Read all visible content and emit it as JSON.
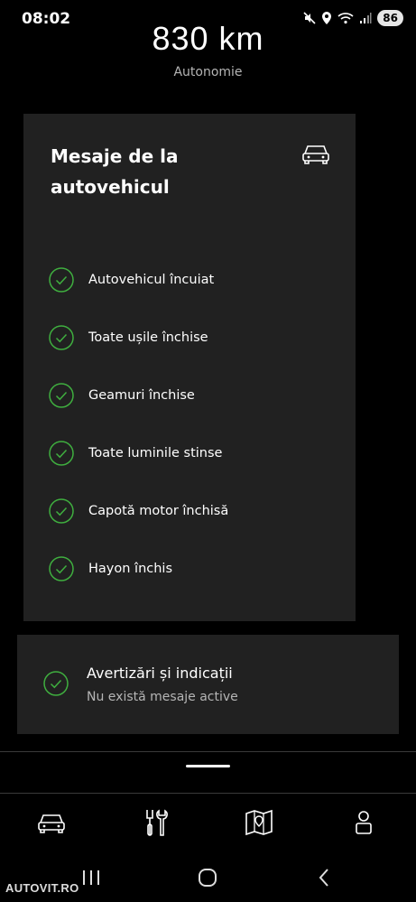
{
  "status_bar": {
    "time": "08:02",
    "battery": "86",
    "icons": [
      "mute-icon",
      "location-icon",
      "wifi-icon",
      "signal-icon"
    ]
  },
  "range": {
    "value": "830 km",
    "label": "Autonomie"
  },
  "vehicle_messages": {
    "title": "Mesaje de la autovehicul",
    "icon": "car-icon",
    "items": [
      {
        "label": "Autovehicul încuiat",
        "status": "ok"
      },
      {
        "label": "Toate ușile închise",
        "status": "ok"
      },
      {
        "label": "Geamuri închise",
        "status": "ok"
      },
      {
        "label": "Toate luminile stinse",
        "status": "ok"
      },
      {
        "label": "Capotă motor închisă",
        "status": "ok"
      },
      {
        "label": "Hayon închis",
        "status": "ok"
      }
    ]
  },
  "warnings": {
    "title": "Avertizări și indicații",
    "subtitle": "Nu există mesaje active",
    "status": "ok"
  },
  "tab_bar": {
    "tabs": [
      {
        "icon": "car-icon",
        "active": true
      },
      {
        "icon": "tools-icon",
        "active": false
      },
      {
        "icon": "map-icon",
        "active": false
      },
      {
        "icon": "profile-icon",
        "active": false
      }
    ]
  },
  "watermark": "AUTOVIT.RO",
  "colors": {
    "background": "#000000",
    "card": "#212121",
    "check_green": "#3fae3f",
    "muted_text": "#b5b5b5"
  }
}
